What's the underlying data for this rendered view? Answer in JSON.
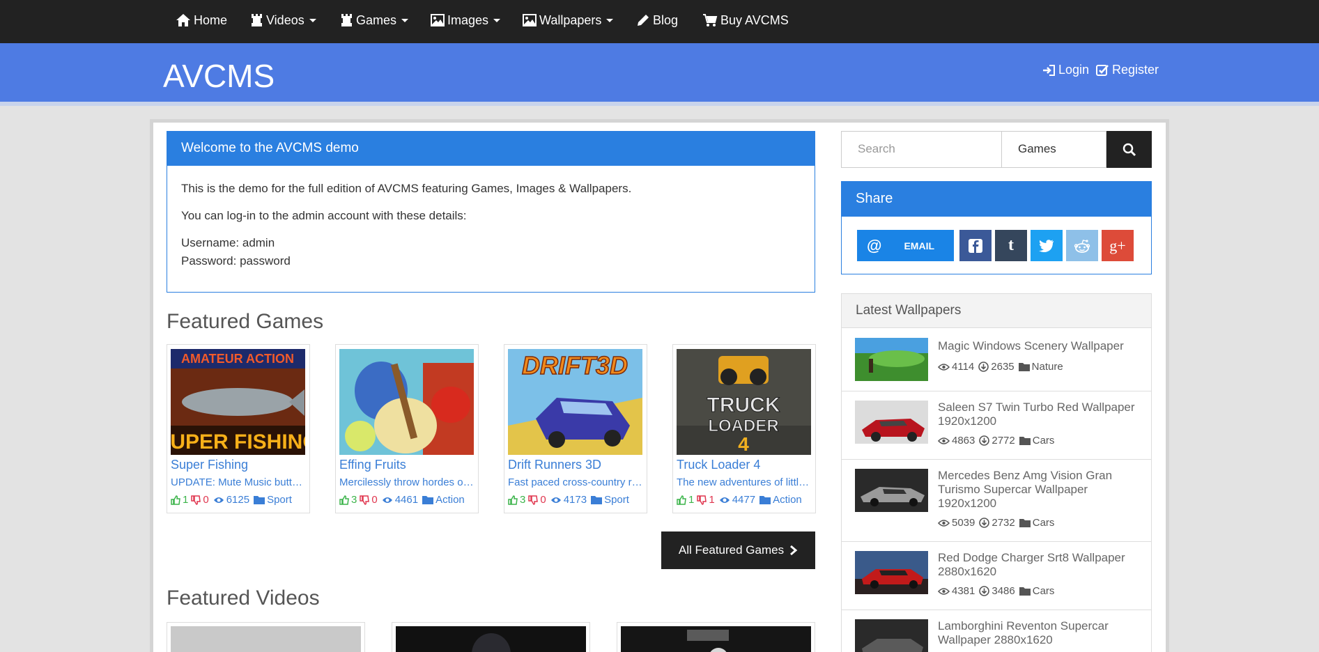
{
  "nav": {
    "items": [
      {
        "label": "Home",
        "icon": "home-icon"
      },
      {
        "label": "Videos",
        "icon": "rook-icon"
      },
      {
        "label": "Games",
        "icon": "rook-icon"
      },
      {
        "label": "Images",
        "icon": "image-icon"
      },
      {
        "label": "Wallpapers",
        "icon": "image-icon"
      },
      {
        "label": "Blog",
        "icon": "pencil-icon"
      },
      {
        "label": "Buy AVCMS",
        "icon": "cart-icon"
      }
    ]
  },
  "header": {
    "brand": "AVCMS",
    "login": "Login",
    "register": "Register",
    "color": "#4e7be3"
  },
  "welcome": {
    "title": "Welcome to the AVCMS demo",
    "line1": "This is the demo for the full edition of AVCMS featuring Games, Images & Wallpapers.",
    "line2": "You can log-in to the admin account with these details:",
    "username": "Username: admin",
    "password": "Password: password"
  },
  "featured_games": {
    "title": "Featured Games",
    "all_button": "All Featured Games",
    "items": [
      {
        "name": "Super Fishing",
        "desc": "UPDATE: Mute Music button added",
        "likes": "1",
        "dislikes": "0",
        "views": "6125",
        "category": "Sport"
      },
      {
        "name": "Effing Fruits",
        "desc": "Mercilessly throw hordes of fruit",
        "likes": "3",
        "dislikes": "0",
        "views": "4461",
        "category": "Action"
      },
      {
        "name": "Drift Runners 3D",
        "desc": "Fast paced cross-country racing",
        "likes": "3",
        "dislikes": "0",
        "views": "4173",
        "category": "Sport"
      },
      {
        "name": "Truck Loader 4",
        "desc": "The new adventures of little truck",
        "likes": "1",
        "dislikes": "1",
        "views": "4477",
        "category": "Action"
      }
    ]
  },
  "featured_videos": {
    "title": "Featured Videos"
  },
  "search": {
    "placeholder": "Search",
    "selected": "Games"
  },
  "share": {
    "title": "Share",
    "email_label": "EMAIL"
  },
  "latest_wallpapers": {
    "title": "Latest Wallpapers",
    "items": [
      {
        "title": "Magic Windows Scenery Wallpaper",
        "views": "4114",
        "downloads": "2635",
        "category": "Nature"
      },
      {
        "title": "Saleen S7 Twin Turbo Red Wallpaper 1920x1200",
        "views": "4863",
        "downloads": "2772",
        "category": "Cars"
      },
      {
        "title": "Mercedes Benz Amg Vision Gran Turismo Supercar Wallpaper 1920x1200",
        "views": "5039",
        "downloads": "2732",
        "category": "Cars"
      },
      {
        "title": "Red Dodge Charger Srt8 Wallpaper 2880x1620",
        "views": "4381",
        "downloads": "3486",
        "category": "Cars"
      },
      {
        "title": "Lamborghini Reventon Supercar Wallpaper 2880x1620",
        "views": "",
        "downloads": "",
        "category": ""
      }
    ]
  }
}
